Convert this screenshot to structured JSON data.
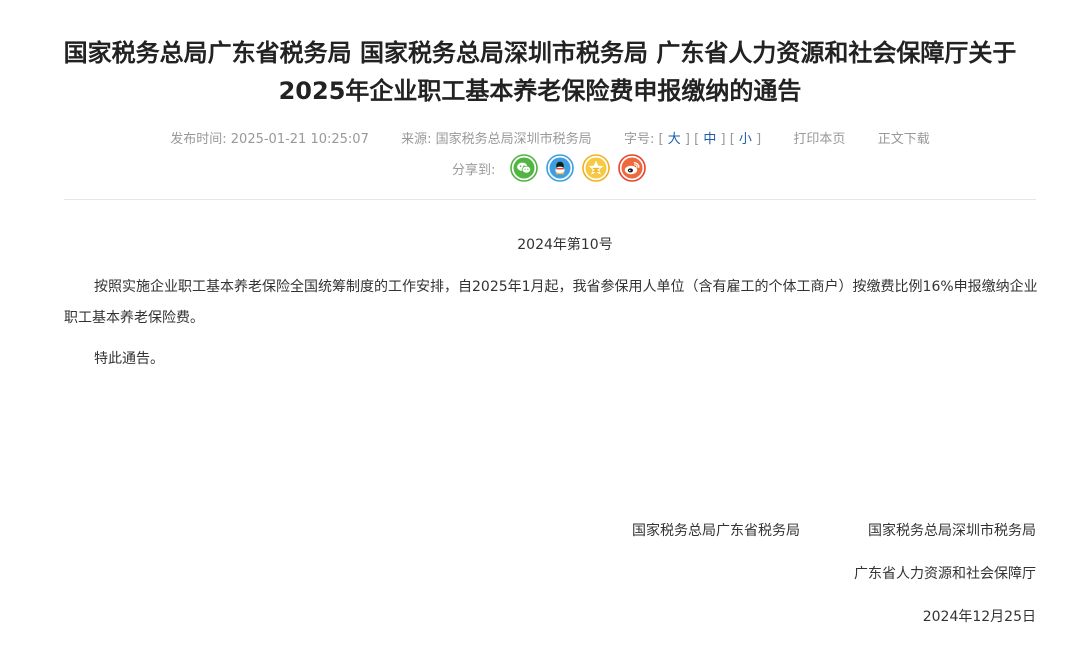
{
  "article": {
    "title_line1": "国家税务总局广东省税务局 国家税务总局深圳市税务局 广东省人力资源和社会保障厅关于",
    "title_line2": "2025年企业职工基本养老保险费申报缴纳的通告",
    "meta": {
      "publish_label": "发布时间:",
      "publish_time": "2025-01-21 10:25:07",
      "source_label": "来源:",
      "source": "国家税务总局深圳市税务局",
      "font_label": "字号:",
      "font_sizes": [
        "大",
        "中",
        "小"
      ],
      "print": "打印本页",
      "download": "正文下载"
    },
    "share": {
      "label": "分享到:",
      "icons": [
        "wechat-icon",
        "qq-icon",
        "qzone-icon",
        "weibo-icon"
      ],
      "colors": {
        "wechat": "#52b442",
        "qq": "#3c9fe1",
        "qzone": "#f2b01e",
        "weibo": "#e6432d"
      }
    },
    "doc_number": "2024年第10号",
    "paragraphs": [
      "按照实施企业职工基本养老保险全国统筹制度的工作安排，自2025年1月起，我省参保用人单位（含有雇工的个体工商户）按缴费比例16%申报缴纳企业职工基本养老保险费。",
      "特此通告。"
    ],
    "signatures": {
      "issuer1": "国家税务总局广东省税务局",
      "issuer2": "国家税务总局深圳市税务局",
      "issuer3": "广东省人力资源和社会保障厅",
      "date": "2024年12月25日"
    }
  }
}
